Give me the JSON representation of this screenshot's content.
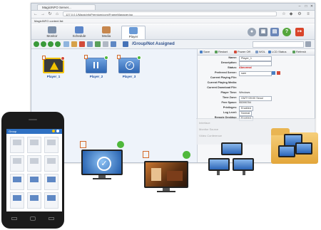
{
  "browser": {
    "tab_title": "MagicINFO Server...",
    "url": "127.0.0.1/MagicInfoPremium/com/FrameManager.jsp",
    "bookmarks_label": "MagicINFO content list",
    "nav": [
      "back-icon",
      "forward-icon",
      "reload-icon",
      "home-icon"
    ]
  },
  "app": {
    "tabs": [
      {
        "label": "Monitor",
        "icon": "monitor-icon",
        "color": "#7a8ea8"
      },
      {
        "label": "Schedule",
        "icon": "calendar-icon",
        "color": "#5c86c9"
      },
      {
        "label": "Media",
        "icon": "media-icon",
        "color": "#c7874e"
      },
      {
        "label": "Player",
        "icon": "player-icon",
        "color": "#6a9ad6"
      }
    ],
    "active_tab": "Player",
    "header_icons": [
      "help-icon",
      "logout-icon"
    ]
  },
  "toolbar": {
    "group_path": "/Group/Not Assigned"
  },
  "players": [
    {
      "name": "Player_1",
      "status": "warning",
      "selected": true
    },
    {
      "name": "Player_2",
      "status": "paused",
      "selected": false
    },
    {
      "name": "Player_3",
      "status": "ok",
      "selected": false
    }
  ],
  "details": {
    "tabs": [
      "Save",
      "Restart",
      "Power Off",
      "WOL",
      "LCD Status",
      "Refresh"
    ],
    "fields": [
      {
        "label": "Name:",
        "value": "Player_1",
        "style": "box"
      },
      {
        "label": "Description:",
        "value": "",
        "style": "box"
      },
      {
        "label": "Status:",
        "value": "Abnormal",
        "style": "red"
      },
      {
        "label": "Preferred Server:",
        "value": "sam",
        "style": "box"
      },
      {
        "label": "Current Playing File:",
        "value": "",
        "style": "plain"
      },
      {
        "label": "Current Playing Media:",
        "value": "",
        "style": "plain"
      },
      {
        "label": "Current Download File:",
        "value": "",
        "style": "plain"
      },
      {
        "label": "Player Time:",
        "value": "Windows",
        "style": "plain"
      },
      {
        "label": "Time Zone:",
        "value": "GMT+09:00 Seoul",
        "style": "box"
      },
      {
        "label": "Free Space:",
        "value": "55396784",
        "style": "plain"
      },
      {
        "label": "Privileges:",
        "value": "Enabled",
        "style": "plain"
      },
      {
        "label": "Log Level:",
        "value": "Normal",
        "style": "plain"
      },
      {
        "label": "Remote Desktop:",
        "value": "Enabled",
        "style": "plain"
      }
    ],
    "sub_items": [
      "Interface",
      "Monitor Source",
      "Video Conference"
    ]
  },
  "phone": {
    "title": "Group"
  },
  "colors": {
    "accent": "#2f71c3",
    "power_on": "#4fb83b",
    "status_error": "#d01f1f",
    "selection": "#f2c200"
  }
}
